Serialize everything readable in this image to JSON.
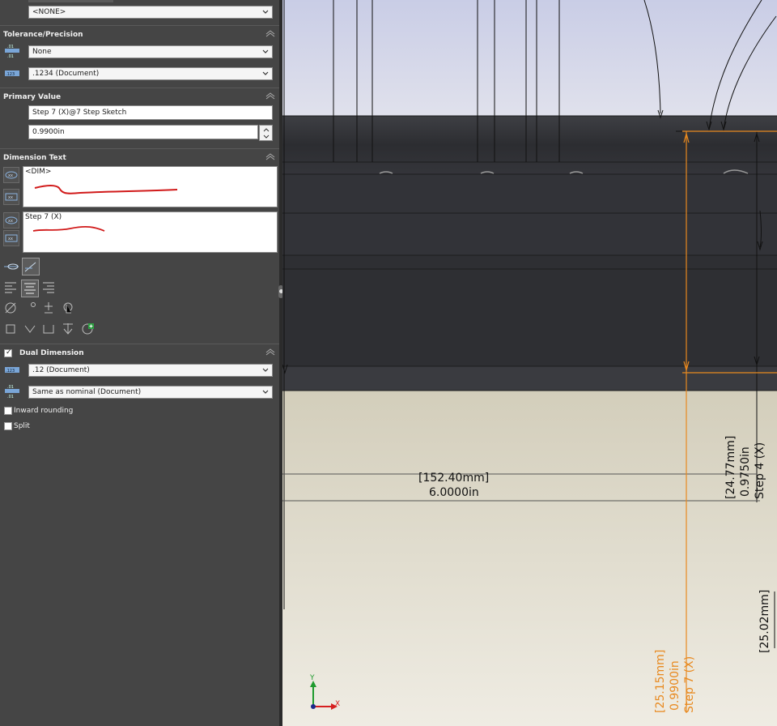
{
  "panel": {
    "top_combo_value": "<NONE>",
    "tolerance": {
      "title": "Tolerance/Precision",
      "type_value": "None",
      "precision_value": ".1234 (Document)"
    },
    "primary_value": {
      "title": "Primary Value",
      "reference": "Step 7 (X)@7 Step Sketch",
      "value": "0.9900in"
    },
    "dimension_text": {
      "title": "Dimension Text",
      "upper_text": "<DIM>",
      "lower_text": "Step 7 (X)"
    },
    "dual_dimension": {
      "title": "Dual Dimension",
      "checked": true,
      "precision_value": ".12 (Document)",
      "tolerance_value": "Same as nominal (Document)"
    },
    "inward_rounding_label": "Inward rounding",
    "split_label": "Split"
  },
  "viewport": {
    "dim_horizontal_mm": "[152.40mm]",
    "dim_horizontal_in": "6.0000in",
    "dim_right_mm": "[24.77mm]",
    "dim_right_in": "0.9750in",
    "dim_right_name": "Step 4 (X)",
    "dim_far_right_mm": "[25.02mm]",
    "dim_selected_mm": "[25.15mm]",
    "dim_selected_in": "0.9900in",
    "dim_selected_name": "Step 7 (X)",
    "triad_y": "Y",
    "triad_x": "X"
  },
  "colors": {
    "panel_bg": "#454545",
    "selected_dim": "#e8891f",
    "annotation_red": "#d11a1a",
    "axis_green": "#1f9a2e",
    "axis_red": "#d62020"
  }
}
